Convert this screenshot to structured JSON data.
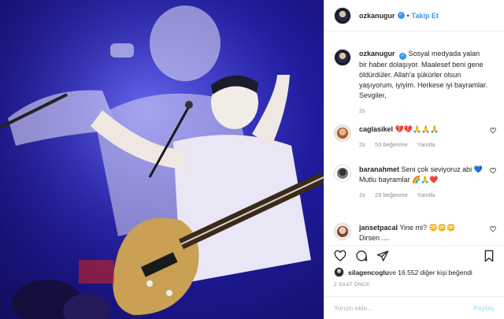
{
  "header": {
    "username": "ozkanugur",
    "separator": "•",
    "follow_label": "Takip Et"
  },
  "caption": {
    "username": "ozkanugur",
    "text": "Sosyal medyada yalan bir haber dolaşıyor. Maalesef beni gene öldürdüler. Allah'a şükürler olsun yaşıyorum, iyiyim. Herkese iyi bayramlar. Sevgiler,",
    "time": "2s"
  },
  "comments": [
    {
      "username": "caglasikel",
      "text": "💔💔🙏🙏🙏",
      "time": "2s",
      "likes": "53 beğenme",
      "reply": "Yanıtla"
    },
    {
      "username": "baranahmet",
      "text": "Seni çok seviyoruz abi 💙 Mutlu bayramlar 🌈🙏❤️",
      "time": "2s",
      "likes": "29 beğenme",
      "reply": "Yanıtla"
    },
    {
      "username": "jansetpacal",
      "text": "Yine mi? 😳😳😳",
      "extra": "Dirsen ...."
    }
  ],
  "likes_text": {
    "user": "silagencoglu",
    "rest": " ve 16.552 diğer kişi beğendi"
  },
  "timestamp": "2 SAAT ÖNCE",
  "comment_input": {
    "placeholder": "Yorum ekle...",
    "post_label": "Paylaş"
  },
  "colors": {
    "link": "#3897f0",
    "muted": "#8e8e8e",
    "border": "#efefef",
    "photo_bg": "#1e1a9a"
  },
  "icons": [
    "verified-icon",
    "heart-icon",
    "comment-icon",
    "share-icon",
    "bookmark-icon"
  ]
}
